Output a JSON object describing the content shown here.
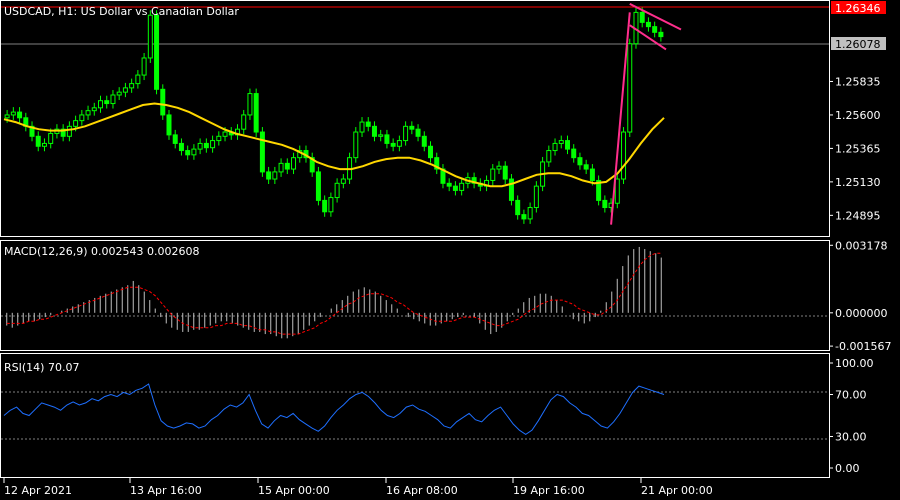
{
  "header": {
    "symbol_line": "USDCAD, H1:  US Dollar vs Canadian Dollar"
  },
  "price_panel": {
    "tag_high": "1.26346",
    "tag_current": "1.26078",
    "tag_high_bg": "#ff0000",
    "tag_current_bg": "#c0c0c0"
  },
  "macd_panel": {
    "label": "MACD(12,26,9) 0.002543 0.002608"
  },
  "rsi_panel": {
    "label": "RSI(14) 70.07"
  },
  "colors": {
    "bull_candle": "#00ff00",
    "bear_candle": "#00ff00",
    "moving_average": "#ffd700",
    "trendline": "#ff2e8c",
    "macd_hist": "#c0c0c0",
    "macd_signal": "#ff0000",
    "rsi_line": "#1e6fff",
    "grid_border": "#ffffff"
  },
  "chart_data": [
    {
      "type": "candlestick",
      "title": "USDCAD, H1:  US Dollar vs Canadian Dollar",
      "y_ticks": [
        "1.26346",
        "1.26078",
        "1.25835",
        "1.25600",
        "1.25365",
        "1.25130",
        "1.24895"
      ],
      "ylim": [
        1.2475,
        1.264
      ],
      "x_ticks": [
        "12 Apr 2021",
        "13 Apr 16:00",
        "15 Apr 00:00",
        "16 Apr 08:00",
        "19 Apr 16:00",
        "21 Apr 00:00"
      ],
      "close_series": [
        1.256,
        1.2562,
        1.2558,
        1.2552,
        1.2545,
        1.2538,
        1.254,
        1.2547,
        1.255,
        1.2545,
        1.2552,
        1.2556,
        1.256,
        1.2563,
        1.2565,
        1.257,
        1.2568,
        1.2574,
        1.2576,
        1.2579,
        1.2582,
        1.2588,
        1.26,
        1.263,
        1.2578,
        1.256,
        1.2546,
        1.254,
        1.2535,
        1.2532,
        1.2536,
        1.254,
        1.2537,
        1.2542,
        1.2545,
        1.2548,
        1.2546,
        1.255,
        1.256,
        1.2575,
        1.2548,
        1.252,
        1.2515,
        1.252,
        1.2526,
        1.2522,
        1.253,
        1.2535,
        1.253,
        1.252,
        1.25,
        1.2492,
        1.2502,
        1.2512,
        1.2515,
        1.253,
        1.2548,
        1.2555,
        1.2552,
        1.2545,
        1.2546,
        1.254,
        1.2538,
        1.2542,
        1.2552,
        1.255,
        1.2545,
        1.2538,
        1.253,
        1.2522,
        1.2512,
        1.251,
        1.2507,
        1.2512,
        1.2516,
        1.2512,
        1.251,
        1.2514,
        1.2522,
        1.2524,
        1.2515,
        1.25,
        1.249,
        1.2487,
        1.2495,
        1.251,
        1.2527,
        1.2535,
        1.254,
        1.2542,
        1.2536,
        1.253,
        1.2525,
        1.2522,
        1.2514,
        1.25,
        1.2495,
        1.2498,
        1.2515,
        1.2548,
        1.261,
        1.2632,
        1.2625,
        1.2622,
        1.2618,
        1.2615
      ],
      "moving_average": [
        1.2557,
        1.2555,
        1.2552,
        1.255,
        1.2549,
        1.2549,
        1.255,
        1.2552,
        1.2555,
        1.2558,
        1.2561,
        1.2564,
        1.2567,
        1.2568,
        1.2567,
        1.2565,
        1.2562,
        1.2558,
        1.2554,
        1.255,
        1.2547,
        1.2545,
        1.2543,
        1.2541,
        1.2539,
        1.2536,
        1.2532,
        1.2527,
        1.2524,
        1.2522,
        1.2522,
        1.2524,
        1.2527,
        1.2529,
        1.253,
        1.253,
        1.2528,
        1.2525,
        1.2521,
        1.2517,
        1.2514,
        1.2512,
        1.251,
        1.251,
        1.2512,
        1.2515,
        1.2518,
        1.2519,
        1.2519,
        1.2517,
        1.2514,
        1.2512,
        1.2513,
        1.2519,
        1.2529,
        1.254,
        1.255,
        1.2558
      ],
      "trendlines": "pink channel lines after 20 Apr"
    },
    {
      "type": "bar",
      "title": "MACD(12,26,9) 0.002543 0.002608",
      "y_ticks": [
        "0.003178",
        "0.000000",
        "-0.001567"
      ],
      "ylim": [
        -0.00175,
        0.00338
      ],
      "histogram": [
        -0.0006,
        -0.0007,
        -0.0006,
        -0.0005,
        -0.0004,
        -0.0004,
        -0.0003,
        -0.0002,
        -0.0001,
        0.0,
        0.0001,
        0.0002,
        0.0003,
        0.0004,
        0.0005,
        0.0006,
        0.0007,
        0.0008,
        0.0009,
        0.001,
        0.0011,
        0.0012,
        0.0013,
        0.0015,
        0.0013,
        0.001,
        0.0006,
        0.0002,
        -0.0002,
        -0.0005,
        -0.0007,
        -0.0008,
        -0.0009,
        -0.0009,
        -0.0008,
        -0.0008,
        -0.0007,
        -0.0006,
        -0.0005,
        -0.0004,
        -0.0004,
        -0.0005,
        -0.0006,
        -0.0007,
        -0.0008,
        -0.0009,
        -0.0009,
        -0.001,
        -0.001,
        -0.0011,
        -0.0012,
        -0.0012,
        -0.0011,
        -0.001,
        -0.0008,
        -0.0006,
        -0.0004,
        -0.0002,
        0.0,
        0.0002,
        0.0004,
        0.0006,
        0.0008,
        0.001,
        0.0011,
        0.0012,
        0.0011,
        0.001,
        0.0008,
        0.0006,
        0.0004,
        0.0002,
        0.0,
        -0.0002,
        -0.0003,
        -0.0004,
        -0.0005,
        -0.0006,
        -0.0006,
        -0.0005,
        -0.0004,
        -0.0003,
        -0.0002,
        -0.0001,
        0.0,
        -0.0002,
        -0.0005,
        -0.0008,
        -0.001,
        -0.0009,
        -0.0007,
        -0.0004,
        -0.0001,
        0.0002,
        0.0005,
        0.0007,
        0.0008,
        0.0009,
        0.0009,
        0.0008,
        0.0006,
        0.0003,
        0.0,
        -0.0003,
        -0.0004,
        -0.0005,
        -0.0004,
        -0.0002,
        0.0001,
        0.0005,
        0.001,
        0.0016,
        0.0022,
        0.0027,
        0.003,
        0.0031,
        0.003,
        0.0029,
        0.0028,
        0.0026
      ],
      "signal": [
        -0.0005,
        -0.0005,
        -0.0005,
        -0.0005,
        -0.0004,
        -0.0004,
        -0.0003,
        -0.0003,
        -0.0002,
        -0.0001,
        0.0,
        0.0001,
        0.0002,
        0.0003,
        0.0004,
        0.0005,
        0.0006,
        0.0007,
        0.0008,
        0.0009,
        0.001,
        0.0011,
        0.0012,
        0.0012,
        0.0012,
        0.0011,
        0.001,
        0.0008,
        0.0005,
        0.0002,
        -0.0001,
        -0.0003,
        -0.0005,
        -0.0006,
        -0.0007,
        -0.0007,
        -0.0007,
        -0.0007,
        -0.0006,
        -0.0006,
        -0.0005,
        -0.0005,
        -0.0005,
        -0.0006,
        -0.0006,
        -0.0007,
        -0.0008,
        -0.0008,
        -0.0009,
        -0.0009,
        -0.001,
        -0.001,
        -0.001,
        -0.001,
        -0.0009,
        -0.0008,
        -0.0007,
        -0.0005,
        -0.0004,
        -0.0002,
        0.0,
        0.0002,
        0.0004,
        0.0005,
        0.0007,
        0.0008,
        0.0009,
        0.0009,
        0.0009,
        0.0008,
        0.0007,
        0.0005,
        0.0004,
        0.0002,
        0.0,
        -0.0001,
        -0.0002,
        -0.0003,
        -0.0004,
        -0.0004,
        -0.0004,
        -0.0004,
        -0.0003,
        -0.0002,
        -0.0002,
        -0.0002,
        -0.0003,
        -0.0004,
        -0.0005,
        -0.0006,
        -0.0006,
        -0.0005,
        -0.0004,
        -0.0003,
        -0.0001,
        0.0001,
        0.0002,
        0.0004,
        0.0005,
        0.0006,
        0.0006,
        0.0006,
        0.0005,
        0.0004,
        0.0002,
        0.0001,
        0.0,
        -0.0001,
        -0.0001,
        0.0001,
        0.0003,
        0.0006,
        0.001,
        0.0014,
        0.0018,
        0.0022,
        0.0025,
        0.0027,
        0.0028,
        0.0028
      ]
    },
    {
      "type": "line",
      "title": "RSI(14) 70.07",
      "y_ticks": [
        "100.00",
        "70.00",
        "30.00",
        "0.00"
      ],
      "ylim": [
        0,
        100
      ],
      "values": [
        50,
        55,
        58,
        52,
        50,
        56,
        62,
        60,
        58,
        55,
        60,
        63,
        60,
        62,
        66,
        64,
        68,
        70,
        68,
        72,
        70,
        74,
        76,
        80,
        60,
        45,
        40,
        38,
        40,
        43,
        42,
        38,
        40,
        46,
        50,
        56,
        60,
        58,
        62,
        70,
        55,
        42,
        38,
        45,
        50,
        48,
        52,
        46,
        42,
        38,
        35,
        40,
        48,
        55,
        60,
        66,
        70,
        72,
        68,
        62,
        55,
        50,
        48,
        52,
        58,
        60,
        56,
        54,
        50,
        46,
        40,
        38,
        44,
        48,
        52,
        46,
        44,
        50,
        55,
        58,
        50,
        42,
        36,
        32,
        36,
        45,
        55,
        65,
        70,
        68,
        62,
        58,
        52,
        50,
        45,
        40,
        38,
        44,
        52,
        62,
        72,
        78,
        76,
        74,
        72,
        70
      ],
      "reference_lines": [
        70,
        30
      ]
    }
  ]
}
